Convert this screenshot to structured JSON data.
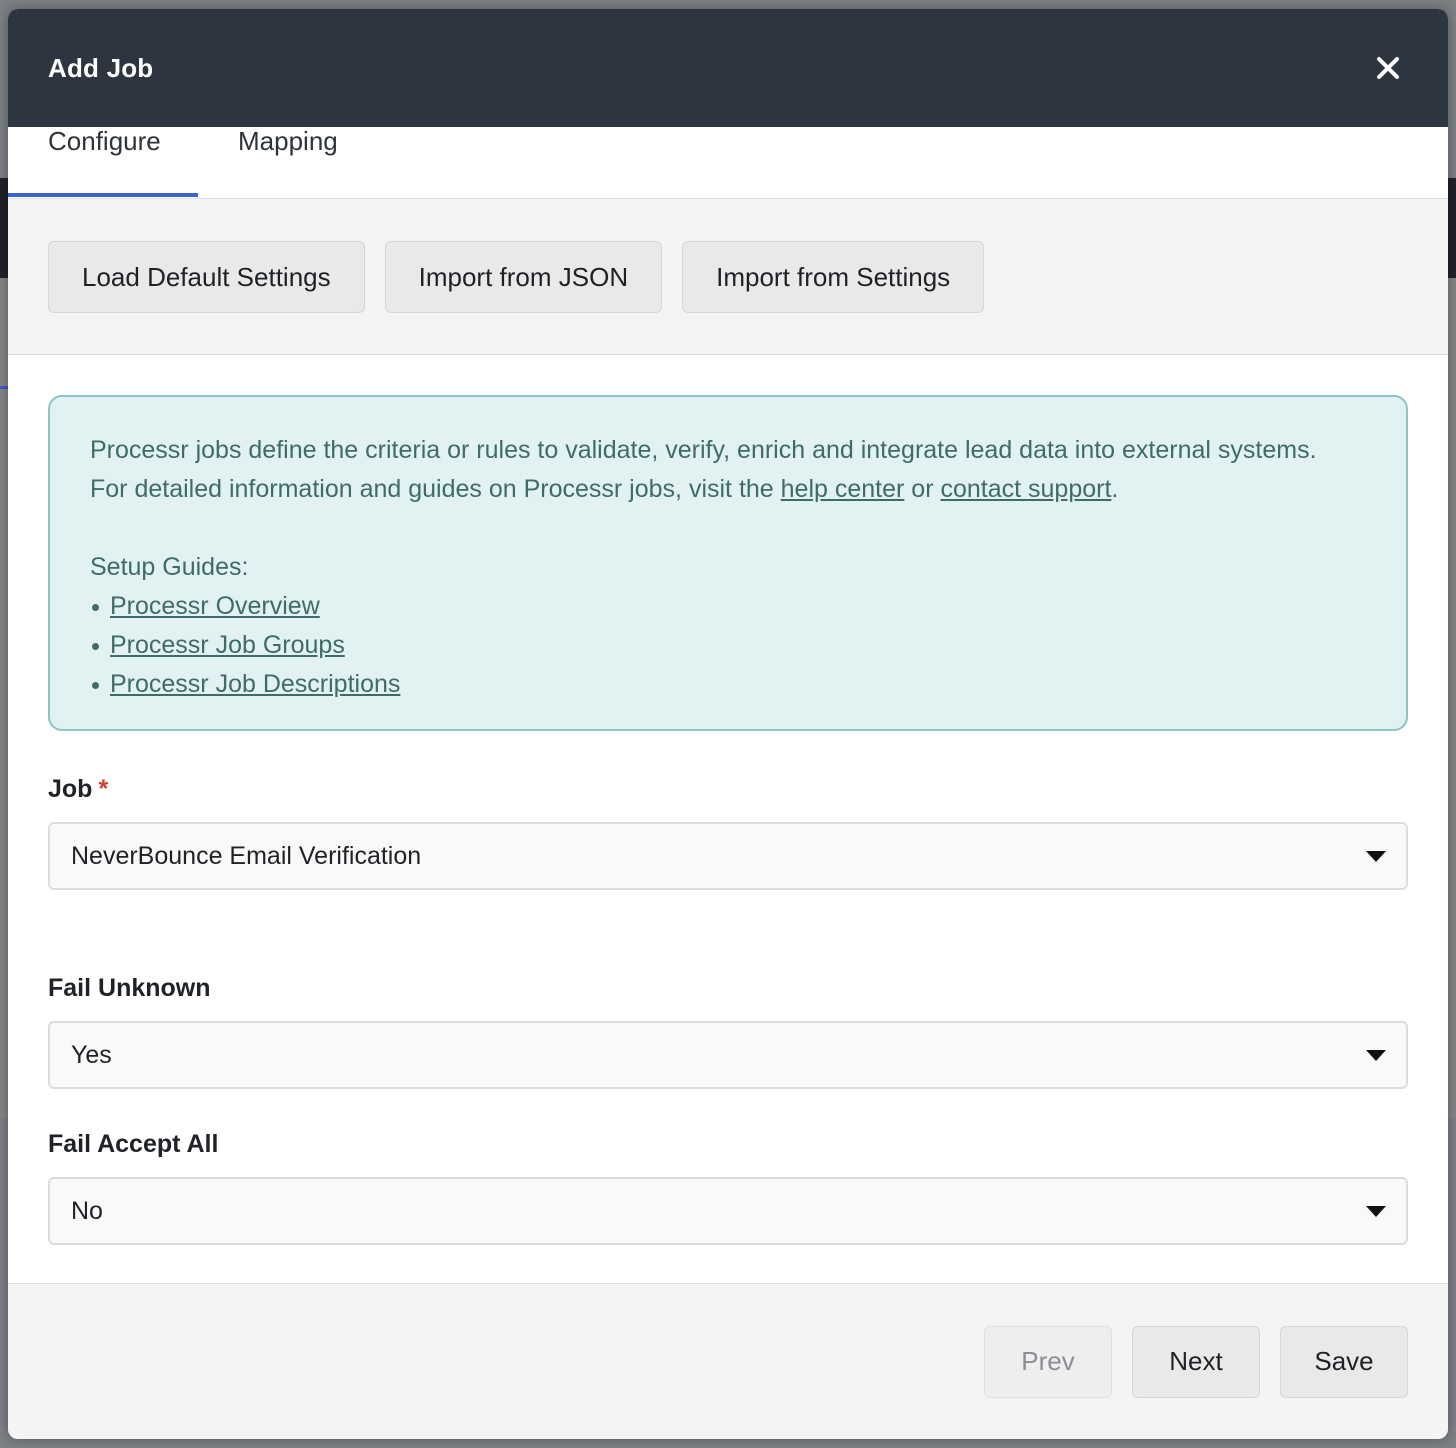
{
  "modal": {
    "title": "Add Job",
    "close_icon": "close-icon"
  },
  "tabs": [
    {
      "label": "Configure",
      "active": true
    },
    {
      "label": "Mapping",
      "active": false
    }
  ],
  "toolbar": {
    "load_default_label": "Load Default Settings",
    "import_json_label": "Import from JSON",
    "import_settings_label": "Import from Settings"
  },
  "info": {
    "line1": "Processr jobs define the criteria or rules to validate, verify, enrich and integrate lead data into external systems.",
    "line2_prefix": "For detailed information and guides on Processr jobs, visit the ",
    "help_center_link": "help center",
    "or_text": " or ",
    "contact_support_link": "contact support",
    "period": ".",
    "setup_guides_label": "Setup Guides:",
    "guides": [
      "Processr Overview",
      "Processr Job Groups",
      "Processr Job Descriptions"
    ]
  },
  "fields": {
    "job": {
      "label": "Job",
      "required_mark": "*",
      "value": "NeverBounce Email Verification"
    },
    "fail_unknown": {
      "label": "Fail Unknown",
      "value": "Yes"
    },
    "fail_accept_all": {
      "label": "Fail Accept All",
      "value": "No"
    }
  },
  "footer": {
    "prev_label": "Prev",
    "next_label": "Next",
    "save_label": "Save"
  },
  "colors": {
    "header_bg": "#2d3540",
    "active_tab": "#3a63d0",
    "info_bg": "#e2f2f2",
    "info_border": "#8ec4c4",
    "required": "#d23a2f"
  }
}
